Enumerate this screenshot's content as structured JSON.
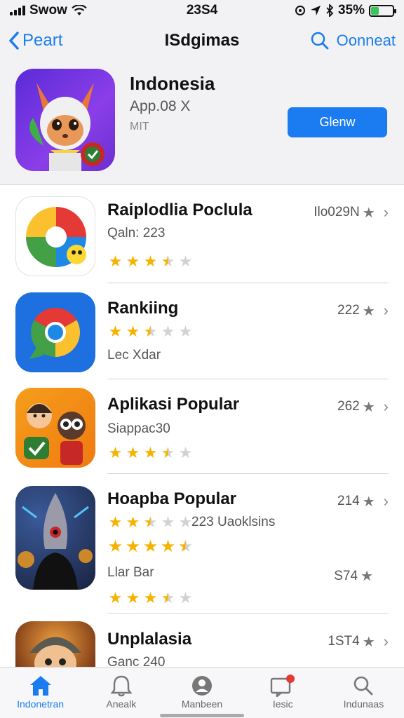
{
  "status_bar": {
    "carrier": "Swow",
    "time": "23S4",
    "battery": "35%",
    "battery_level": 0.35,
    "icons": [
      "signal-icon",
      "wifi-icon",
      "location-icon",
      "bluetooth-icon",
      "battery-icon"
    ]
  },
  "nav": {
    "back_label": "Peart",
    "title": "ISdgimas",
    "action_label": "Oonneat"
  },
  "featured": {
    "name": "Indonesia",
    "subtitle": "App.08 X",
    "meta": "MIT",
    "button_label": "Glenw"
  },
  "apps": [
    {
      "title": "Raiplodlia Poclula",
      "meta": "Qaln: 223",
      "right_value": "Ilo029N",
      "rating": 3.5
    },
    {
      "title": "Rankiing",
      "meta": "Lec Xdar",
      "right_value": "222",
      "rating": 2.5
    },
    {
      "title": "Aplikasi Popular",
      "meta": "Siappac30",
      "right_value": "262",
      "rating": 3.5
    },
    {
      "title": "Hoapba Popular",
      "meta": "223 Uaoklsins",
      "right_value": "214",
      "rating": 2.5,
      "rating2": 4.5,
      "label2": "Llar Bar",
      "right_value2": "S74",
      "rating3": 3.5
    },
    {
      "title": "Unplalasia",
      "meta": "Ganc 240",
      "right_value": "1ST4"
    }
  ],
  "tabs": [
    {
      "label": "Indonetran",
      "icon": "home-icon",
      "active": true
    },
    {
      "label": "Anealk",
      "icon": "bell-icon",
      "active": false
    },
    {
      "label": "Manbeen",
      "icon": "profile-icon",
      "active": false
    },
    {
      "label": "Iesic",
      "icon": "message-icon",
      "active": false
    },
    {
      "label": "Indunaas",
      "icon": "search-icon",
      "active": false
    }
  ],
  "colors": {
    "accent": "#1a7cf0",
    "star": "#f5b301",
    "background": "#f2f2f4"
  }
}
